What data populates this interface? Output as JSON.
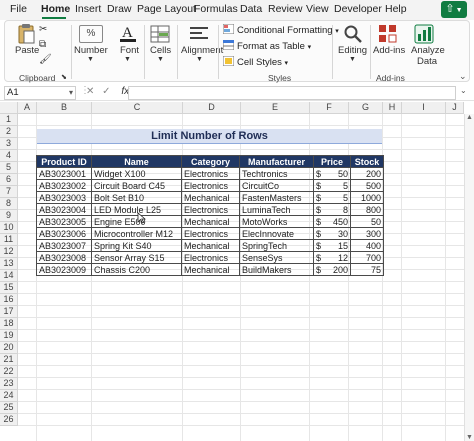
{
  "menu": {
    "tabs": [
      "File",
      "Home",
      "Insert",
      "Draw",
      "Page Layout",
      "Formulas",
      "Data",
      "Review",
      "View",
      "Developer",
      "Help"
    ],
    "active_tab": "Home"
  },
  "ribbon": {
    "paste": "Paste",
    "number": "Number",
    "font": "Font",
    "cells": "Cells",
    "alignment": "Alignment",
    "conditional_formatting": "Conditional Formatting",
    "format_as_table": "Format as Table",
    "cell_styles": "Cell Styles",
    "editing": "Editing",
    "add_ins": "Add-ins",
    "analyze_data_line1": "Analyze",
    "analyze_data_line2": "Data",
    "group_clipboard": "Clipboard",
    "group_styles": "Styles",
    "group_addins": "Add-ins"
  },
  "formula_bar": {
    "name_box": "A1",
    "fx": "fx",
    "formula": ""
  },
  "columns": [
    "A",
    "B",
    "C",
    "D",
    "E",
    "F",
    "G",
    "H",
    "I",
    "J"
  ],
  "rows": [
    "1",
    "2",
    "3",
    "4",
    "5",
    "6",
    "7",
    "8",
    "9",
    "10",
    "11",
    "12",
    "13",
    "14",
    "15",
    "16",
    "17",
    "18",
    "19",
    "20",
    "21",
    "22",
    "23",
    "24",
    "25",
    "26"
  ],
  "sheet": {
    "title": "Limit Number of Rows",
    "headers": [
      "Product ID",
      "Name",
      "Category",
      "Manufacturer",
      "Price",
      "Stock"
    ],
    "currency": "$",
    "records": [
      {
        "id": "AB3023001",
        "name": "Widget X100",
        "category": "Electronics",
        "manufacturer": "Techtronics",
        "price": "50",
        "stock": "200"
      },
      {
        "id": "AB3023002",
        "name": "Circuit Board C45",
        "category": "Electronics",
        "manufacturer": "CircuitCo",
        "price": "5",
        "stock": "500"
      },
      {
        "id": "AB3023003",
        "name": "Bolt Set B10",
        "category": "Mechanical",
        "manufacturer": "FastenMasters",
        "price": "5",
        "stock": "1000"
      },
      {
        "id": "AB3023004",
        "name": "LED Module L25",
        "category": "Electronics",
        "manufacturer": "LuminaTech",
        "price": "8",
        "stock": "800"
      },
      {
        "id": "AB3023005",
        "name": "Engine E500",
        "category": "Mechanical",
        "manufacturer": "MotoWorks",
        "price": "450",
        "stock": "50"
      },
      {
        "id": "AB3023006",
        "name": "Microcontroller M12",
        "category": "Electronics",
        "manufacturer": "ElecInnovate",
        "price": "30",
        "stock": "300"
      },
      {
        "id": "AB3023007",
        "name": "Spring Kit S40",
        "category": "Mechanical",
        "manufacturer": "SpringTech",
        "price": "15",
        "stock": "400"
      },
      {
        "id": "AB3023008",
        "name": "Sensor Array S15",
        "category": "Electronics",
        "manufacturer": "SenseSys",
        "price": "12",
        "stock": "700"
      },
      {
        "id": "AB3023009",
        "name": "Chassis C200",
        "category": "Mechanical",
        "manufacturer": "BuildMakers",
        "price": "200",
        "stock": "75"
      }
    ]
  },
  "colors": {
    "accent": "#107c41",
    "header_fill": "#203764",
    "title_fill": "#d9e1f2"
  }
}
